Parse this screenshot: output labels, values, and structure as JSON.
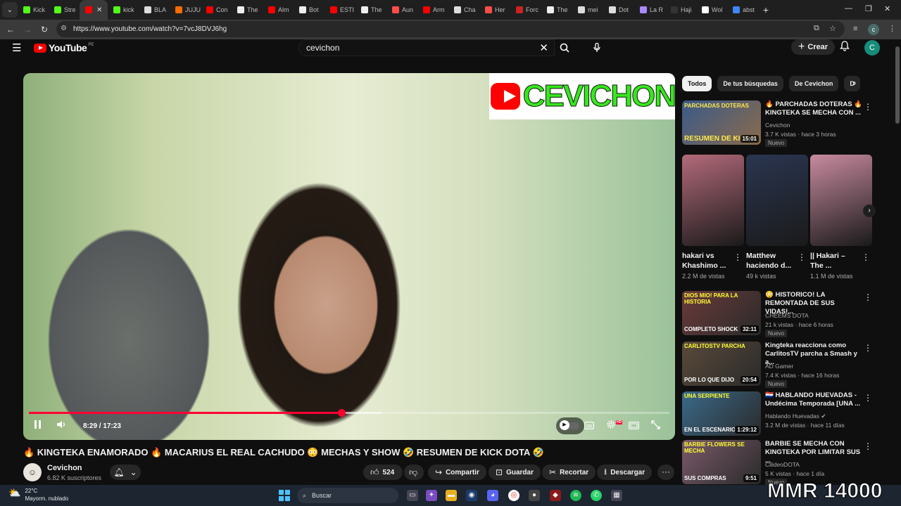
{
  "browser": {
    "tabs": [
      {
        "label": "Kick",
        "color": "#53fc18"
      },
      {
        "label": "Stre",
        "color": "#53fc18"
      },
      {
        "label": "",
        "color": "#ff0000",
        "active": true
      },
      {
        "label": "kick",
        "color": "#53fc18"
      },
      {
        "label": "BLA",
        "color": "#dddddd"
      },
      {
        "label": "JUJU",
        "color": "#ff6a00"
      },
      {
        "label": "Con",
        "color": "#ff0000"
      },
      {
        "label": "The",
        "color": "#eeeeee"
      },
      {
        "label": "Alm",
        "color": "#ff0000"
      },
      {
        "label": "Bot",
        "color": "#eeeeee"
      },
      {
        "label": "ESTI",
        "color": "#ff0000"
      },
      {
        "label": "The",
        "color": "#eeeeee"
      },
      {
        "label": "Aun",
        "color": "#ff4d4d"
      },
      {
        "label": "Arm",
        "color": "#ff0000"
      },
      {
        "label": "Cha",
        "color": "#dddddd"
      },
      {
        "label": "Her",
        "color": "#ff4d4d"
      },
      {
        "label": "Forc",
        "color": "#cc2222"
      },
      {
        "label": "The",
        "color": "#eeeeee"
      },
      {
        "label": "mei",
        "color": "#dddddd"
      },
      {
        "label": "Dot",
        "color": "#dddddd"
      },
      {
        "label": "La R",
        "color": "#aa88ff"
      },
      {
        "label": "Haji",
        "color": "#333333"
      },
      {
        "label": "Wol",
        "color": "#ffffff"
      },
      {
        "label": "abst",
        "color": "#4285f4"
      }
    ],
    "url": "https://www.youtube.com/watch?v=7vcJ8DVJ6hg",
    "profile_letter": "c"
  },
  "youtube": {
    "logo_text": "YouTube",
    "country_code": "PE",
    "search_query": "cevichon",
    "create_label": "Crear",
    "avatar_letter": "C"
  },
  "player": {
    "overlay_logo_text": "CEVICHON",
    "time_display": "8:29 / 17:23",
    "progress_fraction": 0.488,
    "buffered_fraction": 0.55
  },
  "video": {
    "title": "🔥 KINGTEKA ENAMORADO 🔥 MACARIUS EL REAL CACHUDO 😳 MECHAS Y SHOW 🤣 RESUMEN DE KICK DOTA 🤣",
    "channel_name": "Cevichon",
    "channel_subs": "6.82 K suscriptores",
    "likes": "524",
    "share_label": "Compartir",
    "save_label": "Guardar",
    "clip_label": "Recortar",
    "download_label": "Descargar"
  },
  "sidebar": {
    "chips": [
      "Todos",
      "De tus búsquedas",
      "De Cevichon",
      "D"
    ],
    "recommendations_top": [
      {
        "title": "🔥 PARCHADAS DOTERAS 🔥 KINGTEKA SE MECHA CON ...",
        "channel": "Cevichon",
        "meta": "3.7 K vistas · hace 3 horas",
        "badge": "Nuevo",
        "duration": "15:01",
        "thumb_caption_top": "PARCHADAS DOTERAS",
        "thumb_caption_bottom": "RESUMEN DE KICK D"
      }
    ],
    "shorts": [
      {
        "title": "hakari vs Khashimo ...",
        "views": "2.2 M de vistas",
        "color": "#b36a7a"
      },
      {
        "title": "Matthew haciendo d...",
        "views": "49 k vistas",
        "color": "#2a3550"
      },
      {
        "title": "|| Hakari – The ...",
        "views": "1.1 M de vistas",
        "color": "#c88aa0"
      }
    ],
    "recommendations": [
      {
        "title": "😳 HISTORICO! LA REMONTADA DE SUS VIDAS!...",
        "channel": "CHEEMS DOTA",
        "meta": "21 k vistas · hace 6 horas",
        "badge": "Nuevo",
        "duration": "32:11",
        "thumb_caption_top": "DIOS MIO! PARA LA HISTORIA",
        "thumb_caption_bottom": "COMPLETO SHOCK",
        "thumb_color": "#6b3a3a"
      },
      {
        "title": "Kingteka reacciona como CarlitosTV parcha a Smash y a...",
        "channel": "AD Gamer",
        "meta": "7.4 K vistas · hace 16 horas",
        "badge": "Nuevo",
        "duration": "20:54",
        "thumb_caption_top": "CARLITOSTV PARCHA",
        "thumb_caption_bottom": "POR LO QUE DIJO",
        "thumb_color": "#5a4a3a"
      },
      {
        "title": "🇵🇾 HABLANDO HUEVADAS - Undécima Temporada [UNA ...",
        "channel": "Hablando Huevadas ✔",
        "meta": "3.2 M de vistas · hace 11 días",
        "badge": "",
        "duration": "1:29:12",
        "thumb_caption_top": "UNA SERPIENTE",
        "thumb_caption_bottom": "EN EL ESCENARIO",
        "thumb_color": "#3a6a8a"
      },
      {
        "title": "BARBIE SE MECHA CON KINGTEKA POR LIMITAR SUS ...",
        "channel": "CllideoDOTA",
        "meta": "5 K vistas · hace 1 día",
        "badge": "Nuevo",
        "duration": "9:51",
        "thumb_caption_top": "BARBIE FLOWERS SE MECHA",
        "thumb_caption_bottom": "SUS COMPRAS",
        "thumb_color": "#7a5a6a"
      }
    ]
  },
  "taskbar": {
    "temperature": "22°C",
    "weather_text": "Mayorm. nublado",
    "search_label": "Buscar"
  },
  "overlay_text": "MMR 14000"
}
